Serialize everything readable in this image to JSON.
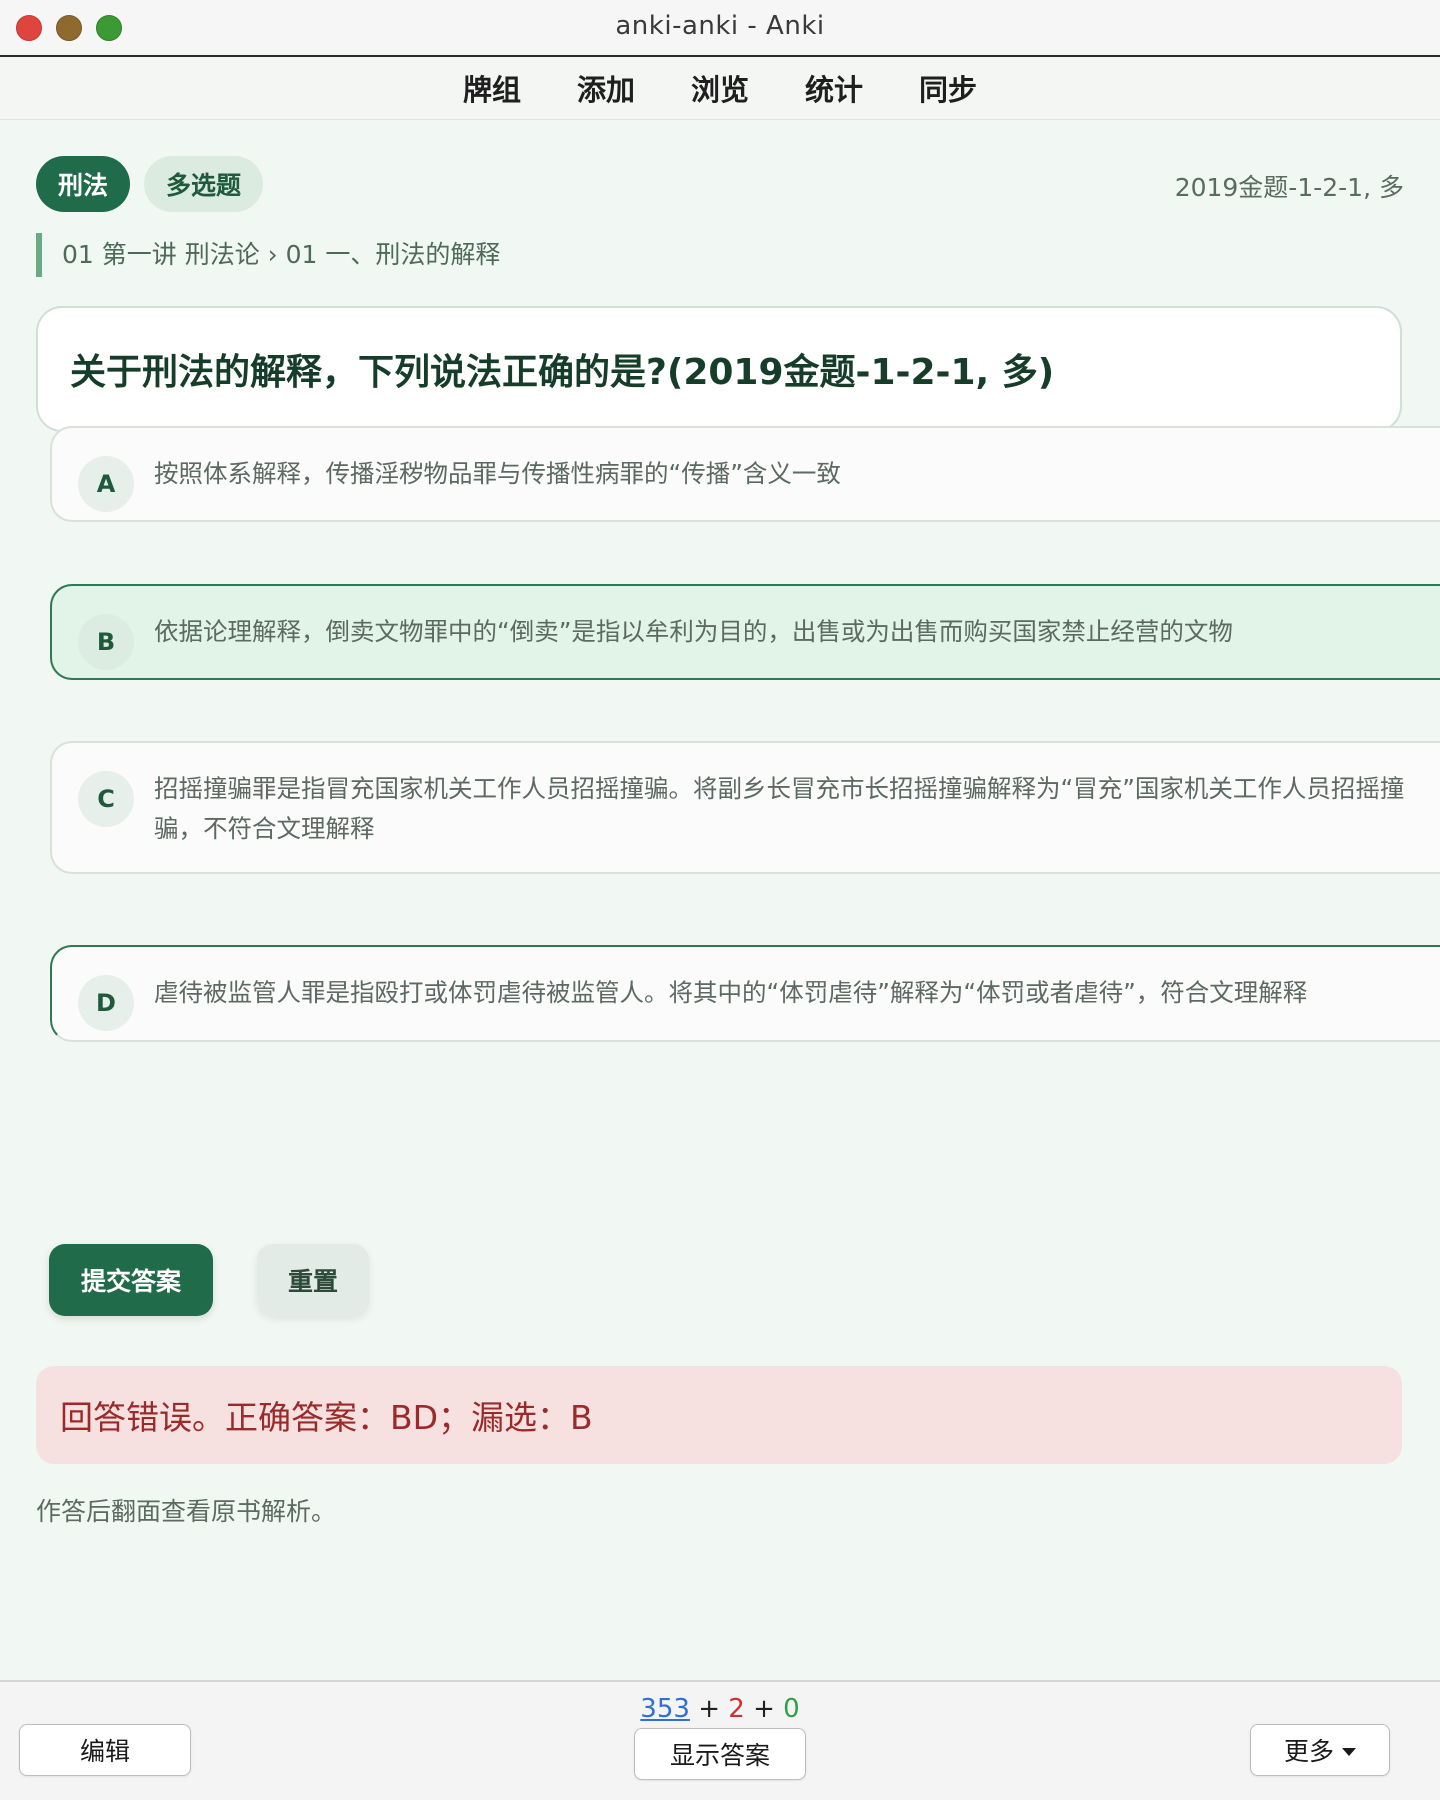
{
  "window": {
    "title": "anki-anki - Anki"
  },
  "topmenu": {
    "items": [
      "牌组",
      "添加",
      "浏览",
      "统计",
      "同步"
    ]
  },
  "card": {
    "tags": {
      "subject": "刑法",
      "type": "多选题"
    },
    "source": "2019金题-1-2-1, 多",
    "breadcrumb": "01 第一讲 刑法论 › 01 一、刑法的解释",
    "question": "关于刑法的解释，下列说法正确的是?(2019金题-1-2-1, 多)",
    "options": [
      {
        "letter": "A",
        "text": "按照体系解释，传播淫秽物品罪与传播性病罪的“传播”含义一致",
        "selected": false
      },
      {
        "letter": "B",
        "text": "依据论理解释，倒卖文物罪中的“倒卖”是指以牟利为目的，出售或为出售而购买国家禁止经营的文物",
        "selected": true
      },
      {
        "letter": "C",
        "text": "招摇撞骗罪是指冒充国家机关工作人员招摇撞骗。将副乡长冒充市长招摇撞骗解释为“冒充”国家机关工作人员招摇撞骗，不符合文理解释",
        "selected": false
      },
      {
        "letter": "D",
        "text": "虐待被监管人罪是指殴打或体罚虐待被监管人。将其中的“体罚虐待”解释为“体罚或者虐待”，符合文理解释",
        "selected": false
      }
    ],
    "buttons": {
      "submit": "提交答案",
      "reset": "重置"
    },
    "result": "回答错误。正确答案：BD；漏选：B",
    "hint": "作答后翻面查看原书解析。"
  },
  "bottombar": {
    "counts": {
      "new": "353",
      "plus1": "+",
      "learn": "2",
      "plus2": "+",
      "review": "0"
    },
    "edit": "编辑",
    "show_answer": "显示答案",
    "more": "更多"
  },
  "colors": {
    "accent": "#1f6b4a",
    "selected_bg": "#e2f3e8",
    "error_bg": "#f6e0e0",
    "error_text": "#9b2b2b",
    "count_new": "#2f6fd6",
    "count_learn": "#d13030",
    "count_review": "#2ea04a"
  }
}
